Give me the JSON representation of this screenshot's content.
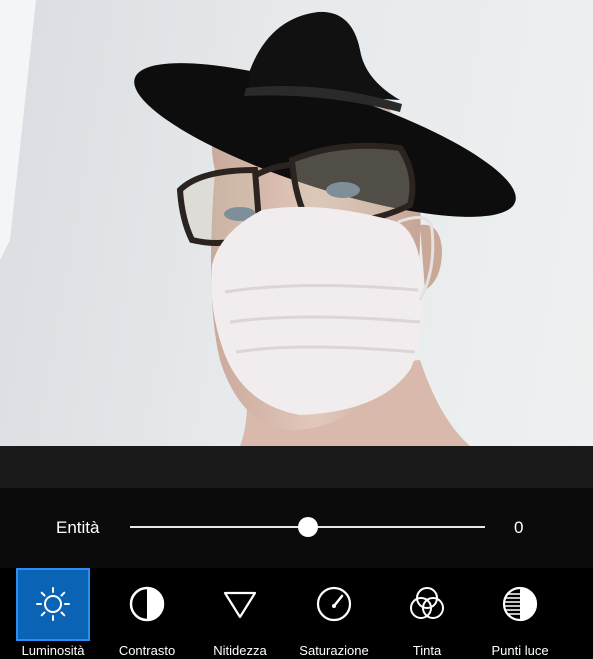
{
  "slider": {
    "label": "Entità",
    "value": "0",
    "position_fraction": 0.5
  },
  "tools": [
    {
      "label": "Luminosità",
      "icon": "sun-icon",
      "active": true
    },
    {
      "label": "Contrasto",
      "icon": "contrast-icon",
      "active": false
    },
    {
      "label": "Nitidezza",
      "icon": "triangle-down-icon",
      "active": false
    },
    {
      "label": "Saturazione",
      "icon": "gauge-icon",
      "active": false
    },
    {
      "label": "Tinta",
      "icon": "color-circles-icon",
      "active": false
    },
    {
      "label": "Punti luce",
      "icon": "highlights-icon",
      "active": false
    }
  ],
  "colors": {
    "accent": "#0b63b5",
    "accent_border": "#2c8ef0",
    "background": "#000000"
  }
}
